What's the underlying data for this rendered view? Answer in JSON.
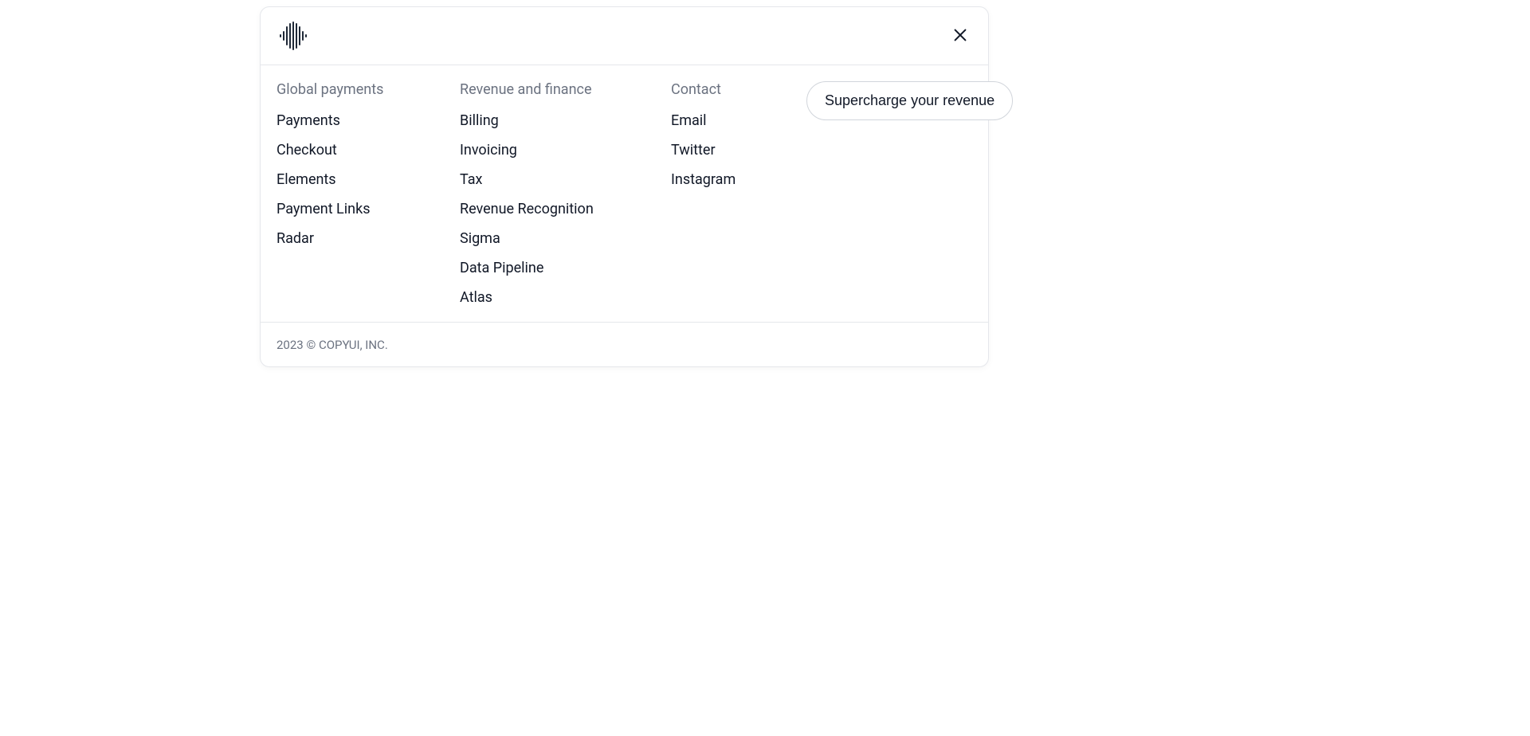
{
  "columns": [
    {
      "title": "Global payments",
      "links": [
        "Payments",
        "Checkout",
        "Elements",
        "Payment Links",
        "Radar"
      ]
    },
    {
      "title": "Revenue and finance",
      "links": [
        "Billing",
        "Invoicing",
        "Tax",
        "Revenue Recognition",
        "Sigma",
        "Data Pipeline",
        "Atlas"
      ]
    },
    {
      "title": "Contact",
      "links": [
        "Email",
        "Twitter",
        "Instagram"
      ]
    }
  ],
  "cta": {
    "label": "Supercharge your revenue"
  },
  "footer": {
    "copyright": "2023 © COPYUI, INC."
  }
}
